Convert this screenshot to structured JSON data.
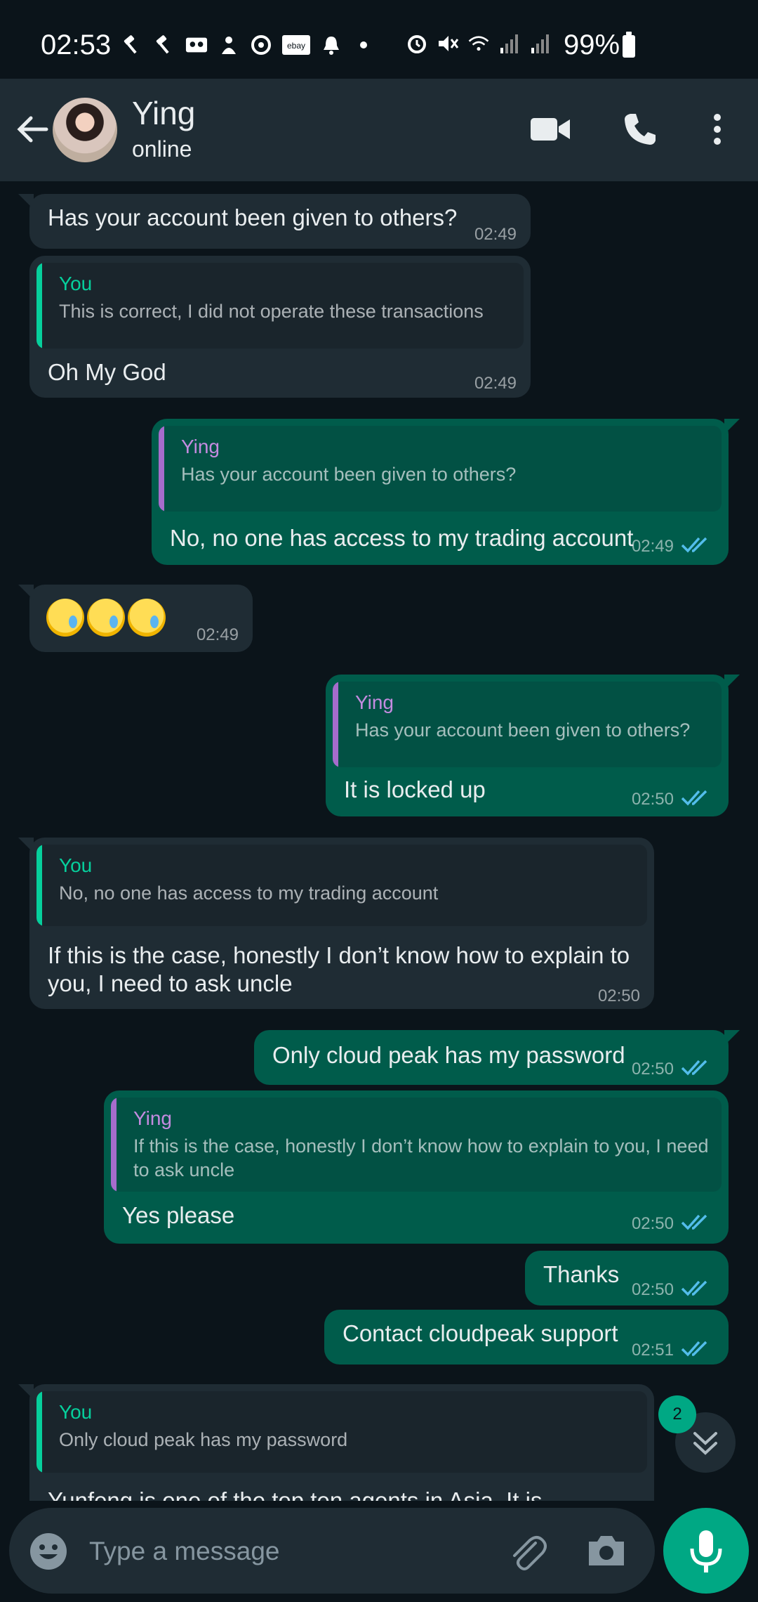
{
  "status_bar": {
    "time": "02:53",
    "battery": "99%",
    "left_icons": [
      "auction-icon",
      "auction-icon",
      "voicemail-icon",
      "person-icon",
      "sync-icon",
      "ebay-icon",
      "bell-icon",
      "dot-icon"
    ],
    "right_icons": [
      "alarm-icon",
      "mute-icon",
      "wifi-icon",
      "signal-icon",
      "signal-icon"
    ],
    "ebay_label": "ebay"
  },
  "header": {
    "contact_name": "Ying",
    "contact_status": "online"
  },
  "messages": [
    {
      "dir": "in",
      "text": "Has your account been given to others?",
      "time": "02:49"
    },
    {
      "dir": "in",
      "quote_author": "You",
      "quote_text": "This is correct, I did not operate these transactions",
      "text": "Oh My God",
      "time": "02:49"
    },
    {
      "dir": "out",
      "quote_author": "Ying",
      "quote_text": "Has your account been given to others?",
      "text": "No, no one has access to my trading account",
      "time": "02:49"
    },
    {
      "dir": "in",
      "emoji": "crying-emoji x3",
      "time": "02:49"
    },
    {
      "dir": "out",
      "quote_author": "Ying",
      "quote_text": "Has your account been given to others?",
      "text": "It is locked up",
      "time": "02:50"
    },
    {
      "dir": "in",
      "quote_author": "You",
      "quote_text": "No, no one has access to my trading account",
      "text": "If this is the case, honestly I don’t know how to explain to you, I need to ask uncle",
      "time": "02:50"
    },
    {
      "dir": "out",
      "text": "Only cloud peak has my password",
      "time": "02:50"
    },
    {
      "dir": "out",
      "quote_author": "Ying",
      "quote_text": "If this is the case, honestly I don’t know how to explain to you, I need to ask uncle",
      "text": "Yes please",
      "time": "02:50"
    },
    {
      "dir": "out",
      "text": "Thanks",
      "time": "02:50"
    },
    {
      "dir": "out",
      "text": "Contact cloudpeak support",
      "time": "02:51"
    },
    {
      "dir": "in",
      "quote_author": "You",
      "quote_text": "Only cloud peak has my password",
      "text": "Yunfeng is one of the top ten agents in Asia. It is",
      "time": ""
    }
  ],
  "unread_badge": "2",
  "composer": {
    "placeholder": "Type a message"
  },
  "colors": {
    "background": "#0b141a",
    "header": "#1f2c34",
    "incoming_bubble": "#1f2c34",
    "outgoing_bubble": "#005c4b",
    "accent": "#00a884",
    "read_ticks": "#53bdeb"
  }
}
